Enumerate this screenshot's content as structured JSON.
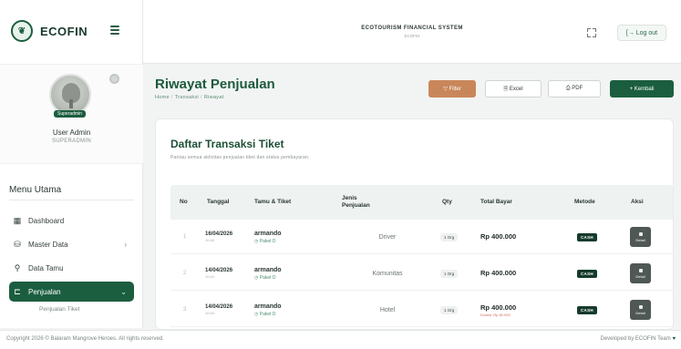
{
  "brand": {
    "name": "ECOFIN",
    "logo_icon": "mangrove-logo-icon"
  },
  "topbar": {
    "system_title": "ECOTOURISM FINANCIAL SYSTEM",
    "system_subtitle": "ECOFIN",
    "logout_label": "[→ Log out"
  },
  "profile": {
    "badge": "Superadmin",
    "name": "User Admin",
    "role": "SUPERADMIN"
  },
  "sidebar": {
    "menu_title": "Menu Utama",
    "items": [
      {
        "label": "Dashboard",
        "icon": "grid-icon",
        "glyph": "▦"
      },
      {
        "label": "Master Data",
        "icon": "database-icon",
        "glyph": "⛁",
        "chevron": "›"
      },
      {
        "label": "Data Tamu",
        "icon": "users-icon",
        "glyph": "⚲"
      },
      {
        "label": "Penjualan",
        "icon": "cart-icon",
        "glyph": "⊏",
        "chevron": "⌄",
        "active": true
      }
    ],
    "submenu": [
      "Penjualan Tiket"
    ]
  },
  "header": {
    "title": "Riwayat Penjualan",
    "breadcrumb": [
      "Home",
      "Transaksi",
      "Riwayat"
    ],
    "buttons": {
      "filter": "▽ Filter",
      "excel": "🗎 Excel",
      "pdf": "⎙ PDF",
      "back": "+ Kembali"
    }
  },
  "card": {
    "title": "Daftar Transaksi Tiket",
    "subtitle": "Pantau semua aktivitas penjualan tiket dan status pembayaran.",
    "columns": {
      "no": "No",
      "date": "Tanggal",
      "guest": "Tamu & Tiket",
      "jenis_a": "Jenis",
      "jenis_b": "Penjualan",
      "qty": "Qty",
      "total": "Total Bayar",
      "method": "Metode",
      "action": "Aksi"
    },
    "rows": [
      {
        "no": "1",
        "date": "16/04/2026",
        "time": "10:45",
        "guest": "armando",
        "ticket": "◷ Paket D",
        "jenis": "Driver",
        "qty": "1 Org",
        "total": "Rp 400.000",
        "total_note": "",
        "method": "CASH",
        "action": "Detail"
      },
      {
        "no": "2",
        "date": "14/04/2026",
        "time": "10:44",
        "guest": "armando",
        "ticket": "◷ Paket D",
        "jenis": "Komunitas",
        "qty": "1 Org",
        "total": "Rp 400.000",
        "total_note": "",
        "method": "CASH",
        "action": "Detail"
      },
      {
        "no": "3",
        "date": "14/04/2026",
        "time": "10:43",
        "guest": "armando",
        "ticket": "◷ Paket D",
        "jenis": "Hotel",
        "qty": "1 Org",
        "total": "Rp 400.000",
        "total_note": "Komisi: Rp 80.000",
        "method": "CASH",
        "action": "Detail"
      }
    ]
  },
  "footer": {
    "left": "Copyright 2026 © Balaram Mangrove Heroes. All rights reserved.",
    "right": "Developed by ECOFIN Team",
    "heart": "♥"
  },
  "colors": {
    "primary": "#1b5e3f",
    "filter": "#c9865a",
    "method_badge": "#153b2b"
  }
}
